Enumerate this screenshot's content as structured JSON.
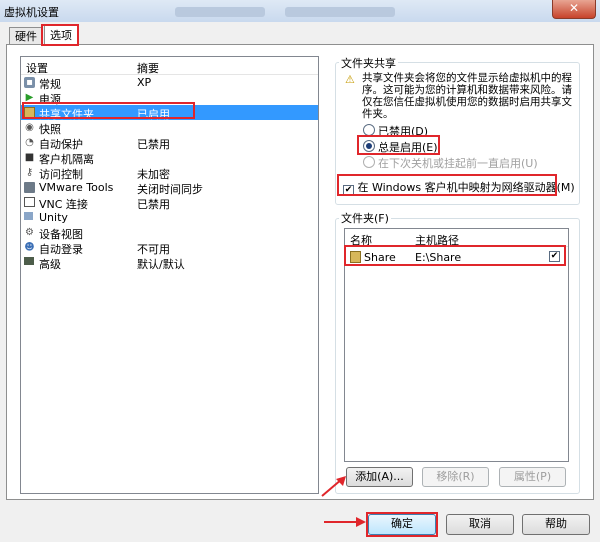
{
  "window": {
    "title": "虚拟机设置",
    "close_glyph": "✕"
  },
  "tabs": [
    {
      "label": "硬件",
      "active": false
    },
    {
      "label": "选项",
      "active": true
    }
  ],
  "settings_list": {
    "headers": {
      "name": "设置",
      "summary": "摘要"
    },
    "items": [
      {
        "name": "常规",
        "summary": "XP",
        "icon": "general-icon"
      },
      {
        "name": "电源",
        "summary": "",
        "icon": "power-play-icon"
      },
      {
        "name": "共享文件夹",
        "summary": "已启用",
        "icon": "shared-folder-icon",
        "selected": true
      },
      {
        "name": "快照",
        "summary": "",
        "icon": "snapshot-icon"
      },
      {
        "name": "自动保护",
        "summary": "已禁用",
        "icon": "autoprotect-icon"
      },
      {
        "name": "客户机隔离",
        "summary": "",
        "icon": "lock-icon"
      },
      {
        "name": "访问控制",
        "summary": "未加密",
        "icon": "access-control-icon"
      },
      {
        "name": "VMware Tools",
        "summary": "关闭时间同步",
        "icon": "vmware-tools-icon"
      },
      {
        "name": "VNC 连接",
        "summary": "已禁用",
        "icon": "vnc-icon"
      },
      {
        "name": "Unity",
        "summary": "",
        "icon": "unity-icon"
      },
      {
        "name": "设备视图",
        "summary": "",
        "icon": "device-view-icon"
      },
      {
        "name": "自动登录",
        "summary": "不可用",
        "icon": "autologin-icon"
      },
      {
        "name": "高级",
        "summary": "默认/默认",
        "icon": "advanced-icon"
      }
    ]
  },
  "folder_sharing": {
    "title": "文件夹共享",
    "description": "共享文件夹会将您的文件显示给虚拟机中的程序。这可能为您的计算机和数据带来风险。请仅在您信任虚拟机使用您的数据时启用共享文件夹。",
    "options": [
      {
        "label": "已禁用(D)",
        "checked": false,
        "disabled": false
      },
      {
        "label": "总是启用(E)",
        "checked": true,
        "disabled": false
      },
      {
        "label": "在下次关机或挂起前一直启用(U)",
        "checked": false,
        "disabled": true
      }
    ],
    "map_drive_label": "在 Windows 客户机中映射为网络驱动器(M)",
    "map_drive_checked": true
  },
  "folders": {
    "title": "文件夹(F)",
    "headers": {
      "name": "名称",
      "host_path": "主机路径"
    },
    "rows": [
      {
        "name": "Share",
        "host_path": "E:\\Share",
        "enabled": true
      }
    ],
    "buttons": {
      "add": "添加(A)...",
      "remove": "移除(R)",
      "properties": "属性(P)"
    }
  },
  "footer": {
    "ok": "确定",
    "cancel": "取消",
    "help": "帮助"
  },
  "colors": {
    "highlight": "#e0262b",
    "selection": "#3399ff"
  }
}
